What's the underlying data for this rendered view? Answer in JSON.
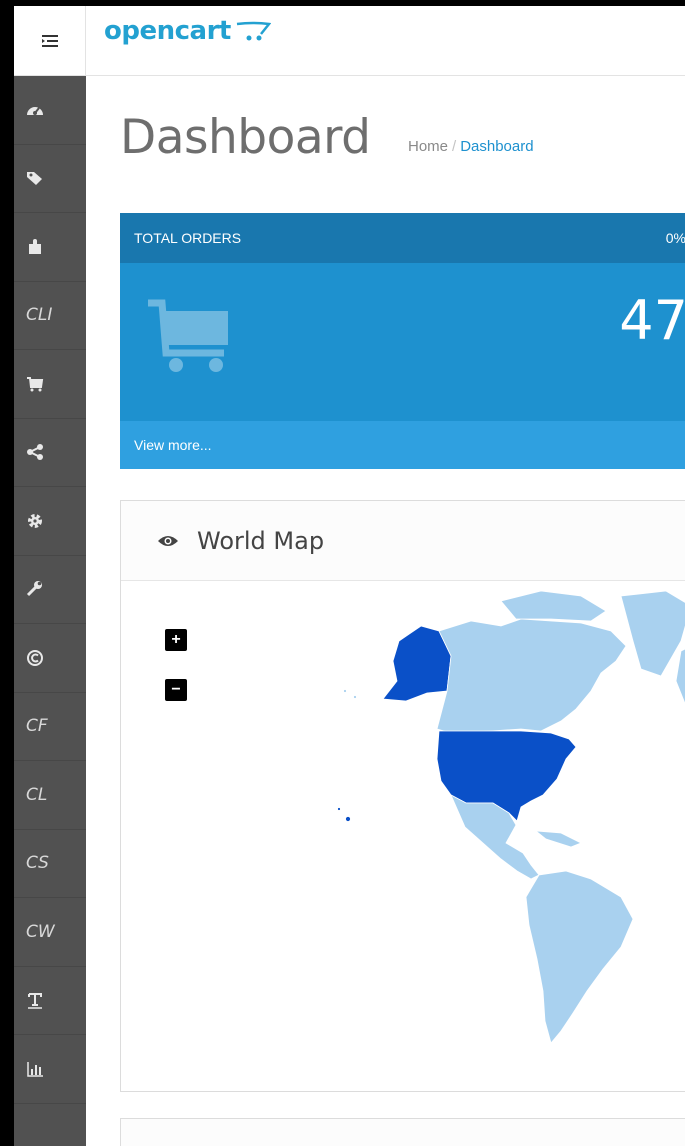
{
  "header": {
    "logo_text": "opencart",
    "menu_icon": "hamburger-icon"
  },
  "sidebar": {
    "items": [
      {
        "icon": "dashboard-icon",
        "label": ""
      },
      {
        "icon": "tags-icon",
        "label": ""
      },
      {
        "icon": "puzzle-icon",
        "label": ""
      },
      {
        "icon": "text-icon",
        "label": "CLI"
      },
      {
        "icon": "cart-icon",
        "label": ""
      },
      {
        "icon": "share-icon",
        "label": ""
      },
      {
        "icon": "gear-icon",
        "label": ""
      },
      {
        "icon": "wrench-icon",
        "label": ""
      },
      {
        "icon": "copyright-icon",
        "label": ""
      },
      {
        "icon": "text-icon",
        "label": "CF"
      },
      {
        "icon": "text-icon",
        "label": "CL"
      },
      {
        "icon": "text-icon",
        "label": "CS"
      },
      {
        "icon": "text-icon",
        "label": "CW"
      },
      {
        "icon": "text-format-icon",
        "label": ""
      },
      {
        "icon": "bar-chart-icon",
        "label": ""
      }
    ]
  },
  "page": {
    "title": "Dashboard",
    "breadcrumb": {
      "home": "Home",
      "separator": "/",
      "current": "Dashboard"
    }
  },
  "tile_orders": {
    "heading": "TOTAL ORDERS",
    "percent": "0%",
    "value": "47",
    "footer": "View more..."
  },
  "map_panel": {
    "title": "World Map",
    "zoom_in": "+",
    "zoom_out": "−",
    "colors": {
      "dark": "#0a50c8",
      "light": "#a9d1ef"
    }
  }
}
